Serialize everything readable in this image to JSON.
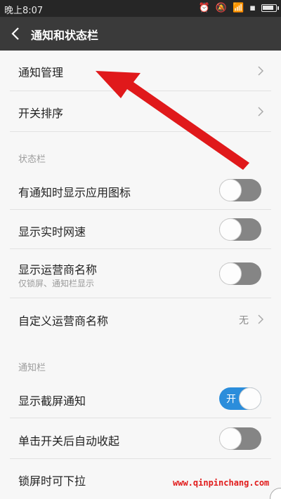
{
  "status_bar": {
    "time": "晚上8:07",
    "icons": [
      "alarm-icon",
      "mute-icon",
      "wifi-icon",
      "sim-icon",
      "battery-icon"
    ]
  },
  "header": {
    "title": "通知和状态栏"
  },
  "rows_top": [
    {
      "label": "通知管理"
    },
    {
      "label": "开关排序"
    }
  ],
  "section_status": "状态栏",
  "status_items": [
    {
      "label": "有通知时显示应用图标",
      "toggle": false
    },
    {
      "label": "显示实时网速",
      "toggle": false
    },
    {
      "label": "显示运营商名称",
      "sub": "仅锁屏、通知栏显示",
      "toggle": false
    },
    {
      "label": "自定义运营商名称",
      "value": "无"
    }
  ],
  "section_notify": "通知栏",
  "notify_items": [
    {
      "label": "显示截屏通知",
      "toggle": true,
      "on_text": "开"
    },
    {
      "label": "单击开关后自动收起",
      "toggle": false
    },
    {
      "label": "锁屏时可下拉"
    }
  ],
  "watermark": "www.qinpinchang.com",
  "colors": {
    "header": "#3a3a3a",
    "toggle_on": "#2b8ddb",
    "toggle_off": "#858585",
    "arrow": "#e0191b"
  }
}
